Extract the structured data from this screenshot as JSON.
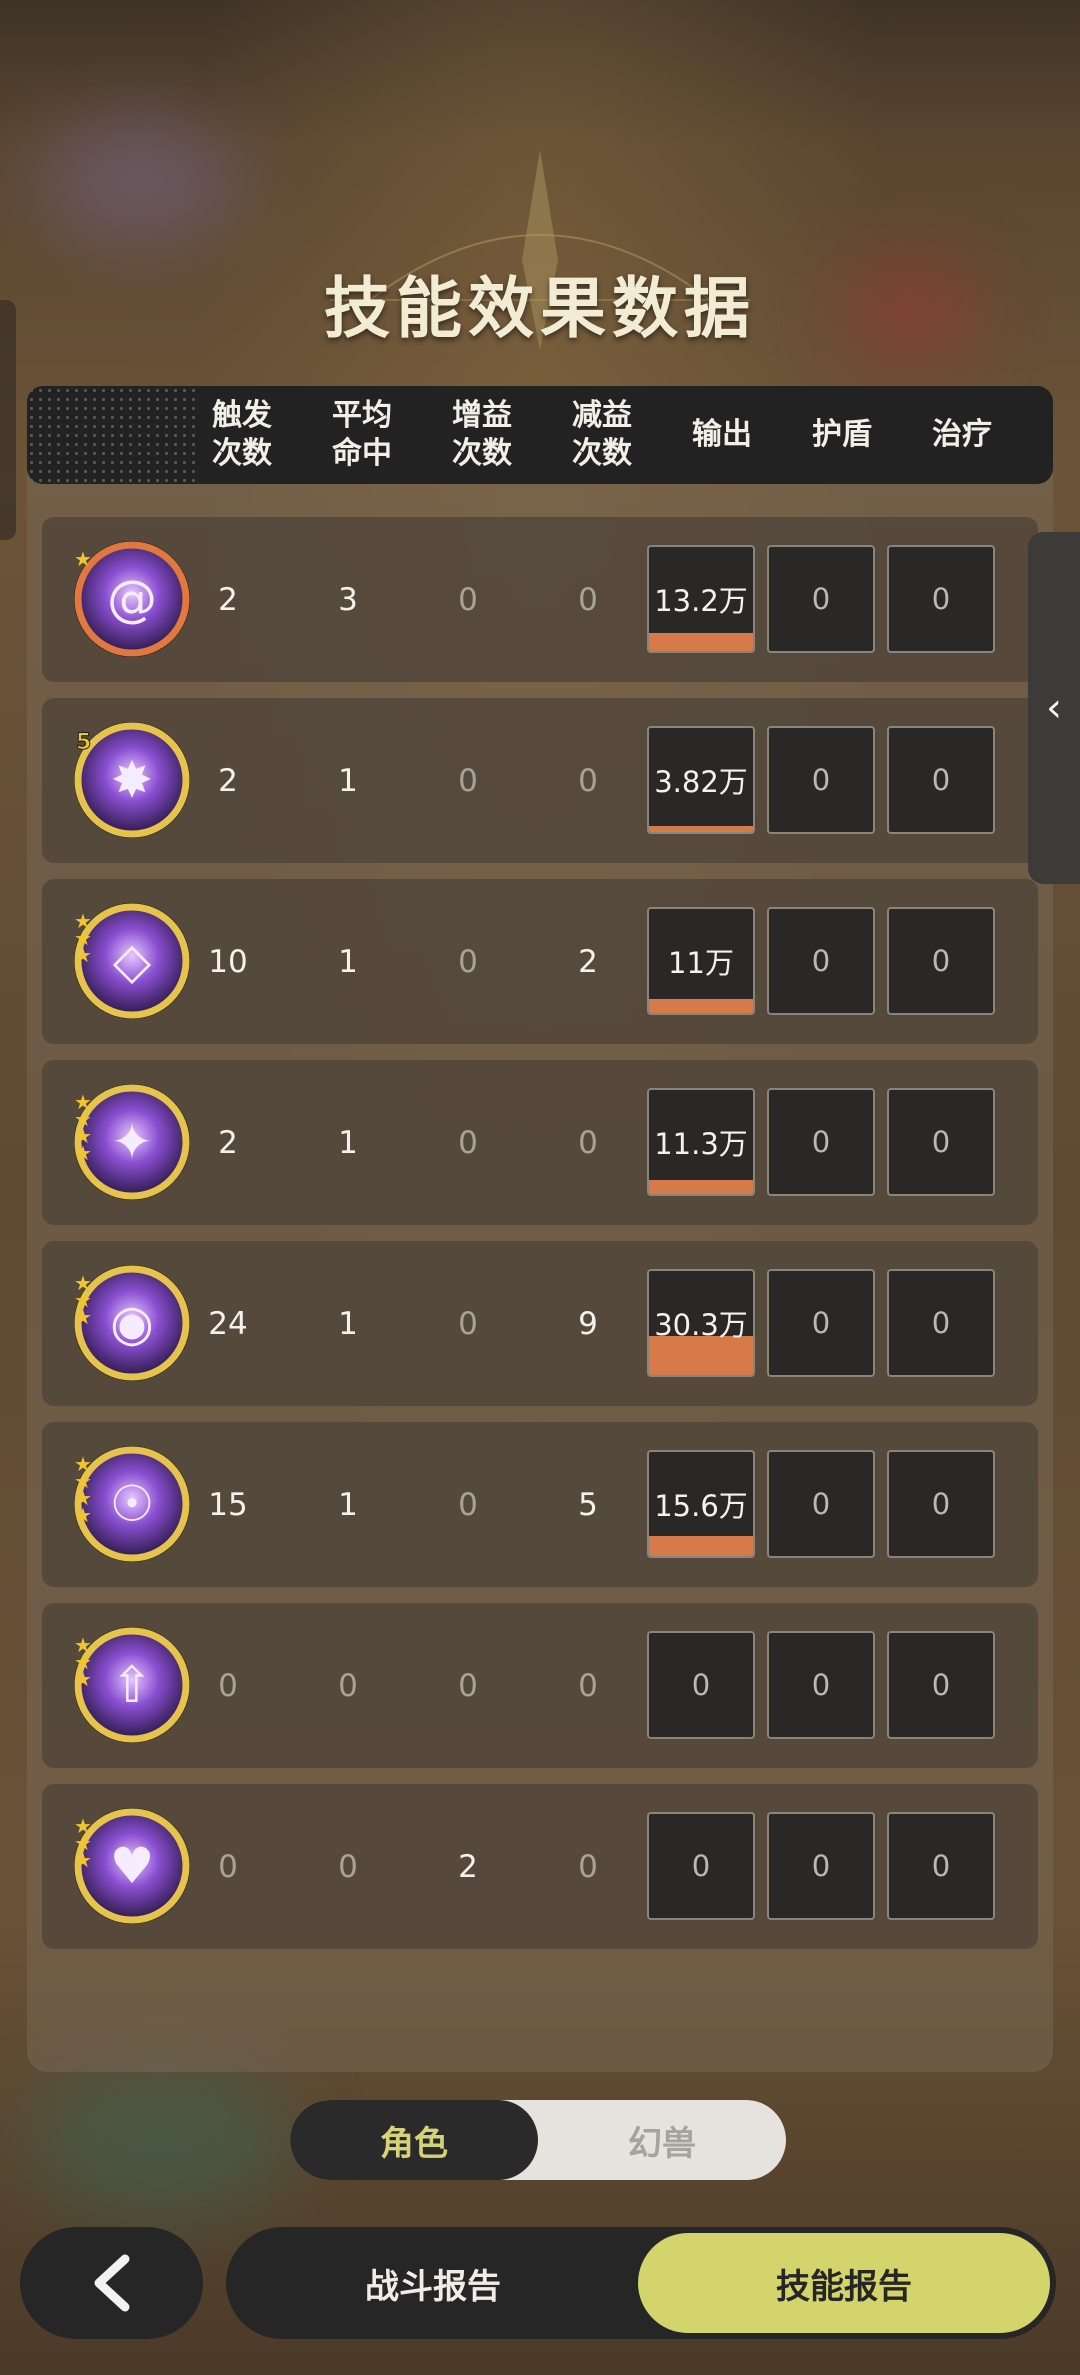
{
  "title": "技能效果数据",
  "header": {
    "columns": [
      "触发\n次数",
      "平均\n命中",
      "增益\n次数",
      "减益\n次数",
      "输出",
      "护盾",
      "治疗"
    ]
  },
  "rows": [
    {
      "icon": "vortex-orb-icon",
      "rank": "",
      "stars": 1,
      "ring": "#e07840",
      "trigger": "2",
      "avg_hit": "3",
      "buff": "0",
      "debuff": "0",
      "output": "13.2万",
      "output_share": 0.25,
      "shield": "0",
      "heal": "0"
    },
    {
      "icon": "starburst-icon",
      "rank": "5",
      "stars": 0,
      "ring": "#e6c34a",
      "trigger": "2",
      "avg_hit": "1",
      "buff": "0",
      "debuff": "0",
      "output": "3.82万",
      "output_share": 0.07,
      "shield": "0",
      "heal": "0"
    },
    {
      "icon": "diamond-flame-icon",
      "rank": "",
      "stars": 3,
      "ring": "#e6c34a",
      "trigger": "10",
      "avg_hit": "1",
      "buff": "0",
      "debuff": "2",
      "output": "11万",
      "output_share": 0.2,
      "shield": "0",
      "heal": "0"
    },
    {
      "icon": "four-point-star-icon",
      "rank": "",
      "stars": 4,
      "ring": "#e6c34a",
      "trigger": "2",
      "avg_hit": "1",
      "buff": "0",
      "debuff": "0",
      "output": "11.3万",
      "output_share": 0.2,
      "shield": "0",
      "heal": "0"
    },
    {
      "icon": "eye-sigil-icon",
      "rank": "",
      "stars": 3,
      "ring": "#e6c34a",
      "trigger": "24",
      "avg_hit": "1",
      "buff": "0",
      "debuff": "9",
      "output": "30.3万",
      "output_share": 0.56,
      "shield": "0",
      "heal": "0"
    },
    {
      "icon": "hooded-eye-icon",
      "rank": "",
      "stars": 4,
      "ring": "#e6c34a",
      "trigger": "15",
      "avg_hit": "1",
      "buff": "0",
      "debuff": "5",
      "output": "15.6万",
      "output_share": 0.29,
      "shield": "0",
      "heal": "0"
    },
    {
      "icon": "upward-arrow-icon",
      "rank": "",
      "stars": 3,
      "ring": "#e6c34a",
      "trigger": "0",
      "avg_hit": "0",
      "buff": "0",
      "debuff": "0",
      "output": "0",
      "output_share": 0,
      "shield": "0",
      "heal": "0"
    },
    {
      "icon": "heart-hood-icon",
      "rank": "",
      "stars": 3,
      "ring": "#e6c34a",
      "trigger": "0",
      "avg_hit": "0",
      "buff": "2",
      "debuff": "0",
      "output": "0",
      "output_share": 0,
      "shield": "0",
      "heal": "0"
    }
  ],
  "toggle": {
    "role": "角色",
    "beast": "幻兽",
    "active": "role"
  },
  "bottom": {
    "battle_report": "战斗报告",
    "skill_report": "技能报告",
    "active": "skill_report"
  },
  "colors": {
    "accent": "#d3d46c",
    "output_bar": "#d77a4a"
  }
}
